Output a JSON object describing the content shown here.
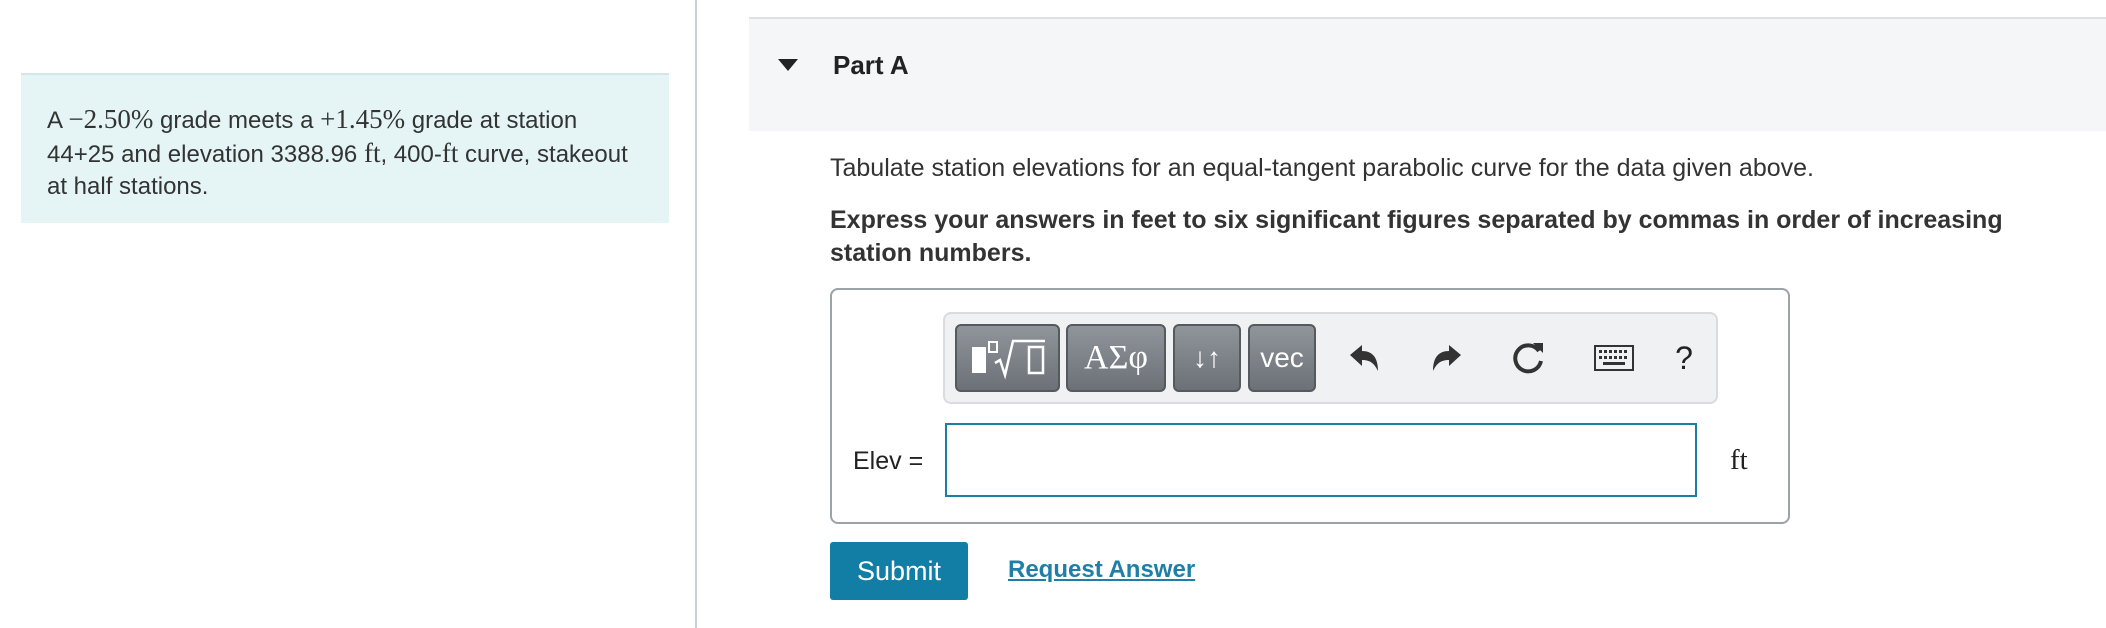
{
  "problem": {
    "text_1": "A ",
    "grade_1": "−2.50%",
    "text_2": " grade meets a ",
    "grade_2": "+1.45%",
    "text_3": " grade at station 44+25 and elevation 3388.96 ",
    "unit_ft": "ft",
    "text_4": ", 400-",
    "unit_ft_2": "ft",
    "text_5": " curve, stakeout at half stations."
  },
  "part": {
    "title": "Part A"
  },
  "question": {
    "prompt": "Tabulate station elevations for an equal-tangent parabolic curve for the data given above.",
    "instruction": "Express your answers in feet to six significant figures separated by commas in order of increasing station numbers."
  },
  "toolbar": {
    "greek_label": "ΑΣφ",
    "arrows_label": "↓↑",
    "vec_label": "vec",
    "help_label": "?",
    "icons": [
      "templates-icon",
      "undo-icon",
      "redo-icon",
      "reset-icon",
      "keyboard-icon"
    ]
  },
  "answer": {
    "label": "Elev =",
    "value": "",
    "unit": "ft"
  },
  "actions": {
    "submit_label": "Submit",
    "request_label": "Request Answer"
  },
  "colors": {
    "problem_bg": "#e5f5f5",
    "accent": "#127ea6",
    "link": "#1f7fa6",
    "toolbar_button": "#7a8085"
  }
}
